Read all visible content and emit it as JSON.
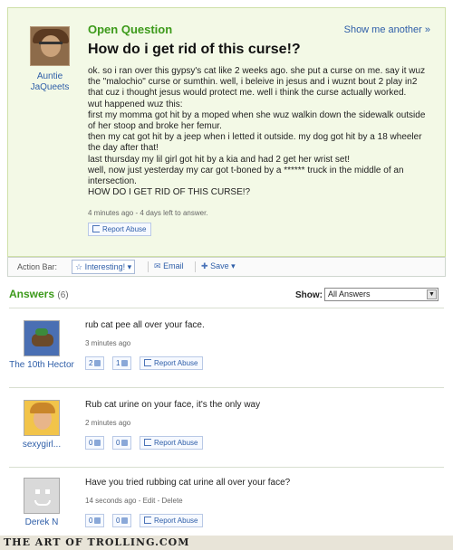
{
  "question": {
    "status_label": "Open Question",
    "show_another": "Show me another »",
    "user": "Auntie JaQueets",
    "title": "How do i get rid of this curse!?",
    "body": [
      "ok. so i ran over this gypsy's cat like 2 weeks ago. she put a curse on me. say it wuz",
      "the \"malochio\" curse or sumthin. well, i beleive in jesus and i wuznt bout 2 play in2",
      "that cuz i thought jesus would protect me. well i think the curse actually worked.",
      "wut happened wuz this:",
      "first my momma got hit by a moped when she wuz walkin down the sidewalk outside",
      "of her stoop and broke her femur.",
      "then my cat got hit by a jeep when i letted it outside. my dog got hit by a 18 wheeler",
      "the day after that!",
      "last thursday my lil girl got hit by a kia and had 2 get her wrist set!",
      "well, now just yesterday my car got t-boned by a ****** truck in the middle of an",
      "intersection.",
      "HOW DO I GET RID OF THIS CURSE!?"
    ],
    "meta": "4 minutes ago - 4 days left to answer.",
    "report_label": "Report Abuse"
  },
  "action_bar": {
    "label": "Action Bar:",
    "interesting": "Interesting!",
    "email": "Email",
    "save": "Save"
  },
  "answers": {
    "heading": "Answers",
    "count": "(6)",
    "show_label": "Show:",
    "show_value": "All Answers",
    "items": [
      {
        "user": "The 10th Hector",
        "text": "rub cat pee all over your face.",
        "meta": "3 minutes ago",
        "up": "2",
        "down": "1",
        "report": "Report Abuse"
      },
      {
        "user": "sexygirl...",
        "text": "Rub cat urine on your face, it's the only way",
        "meta": "2 minutes ago",
        "up": "0",
        "down": "0",
        "report": "Report Abuse"
      },
      {
        "user": "Derek N",
        "text": "Have you tried rubbing cat urine all over your face?",
        "meta": "14 seconds ago - Edit - Delete",
        "up": "0",
        "down": "0",
        "report": "Report Abuse"
      }
    ]
  },
  "footer": {
    "watermark": "THE ART OF TROLLING.COM"
  },
  "colors": {
    "accent_green": "#3c9a1a",
    "link_blue": "#2e5ea8",
    "question_bg": "#f3f9e6"
  }
}
